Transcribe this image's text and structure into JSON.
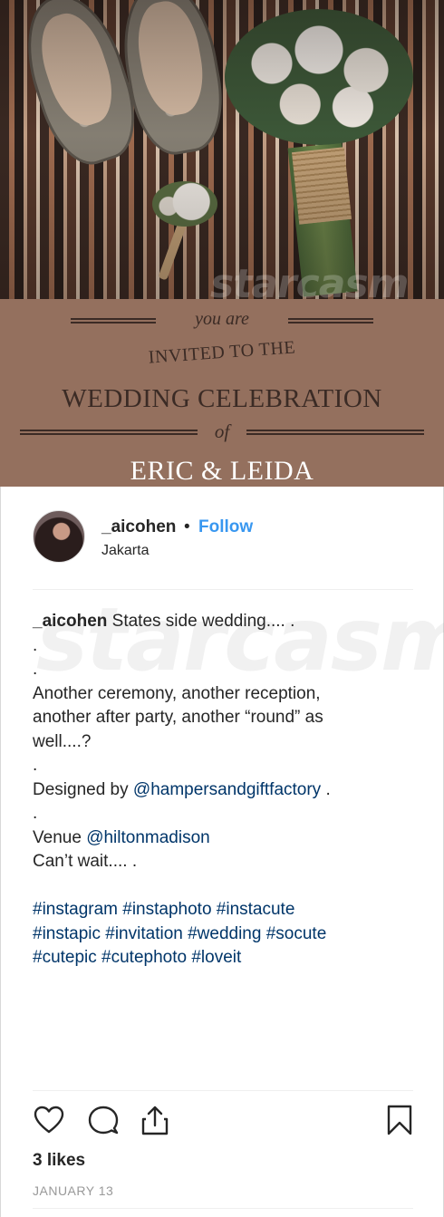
{
  "invitation": {
    "you_are": "you are",
    "invited_to_the": "INVITED TO THE",
    "wedding_celebration": "WEDDING CELEBRATION",
    "of": "of",
    "names": "ERIC & LEIDA",
    "watermark": "starcasm"
  },
  "post": {
    "header": {
      "username": "_aicohen",
      "separator": "•",
      "follow_label": "Follow",
      "location": "Jakarta"
    },
    "caption": {
      "username": "_aicohen",
      "lines": [
        "States side wedding.... .",
        ".",
        ".",
        "Another ceremony, another reception,",
        "another after party, another “round” as",
        "well....?",
        ".",
        "Designed by",
        "@hampersandgiftfactory",
        ".",
        ".",
        "Venue",
        "@hiltonmadison",
        "Can’t wait.... .",
        "#instagram #instaphoto #instacute",
        "#instapic #invitation #wedding #socute",
        "#cutepic #cutephoto #loveit"
      ]
    },
    "watermark": "starcasm",
    "likes": "3 likes",
    "date": "JANUARY 13",
    "colors": {
      "follow": "#3897f0",
      "link": "#003569",
      "text": "#262626",
      "muted": "#999999"
    },
    "icons": [
      "heart-icon",
      "comment-icon",
      "share-icon",
      "bookmark-icon"
    ]
  }
}
